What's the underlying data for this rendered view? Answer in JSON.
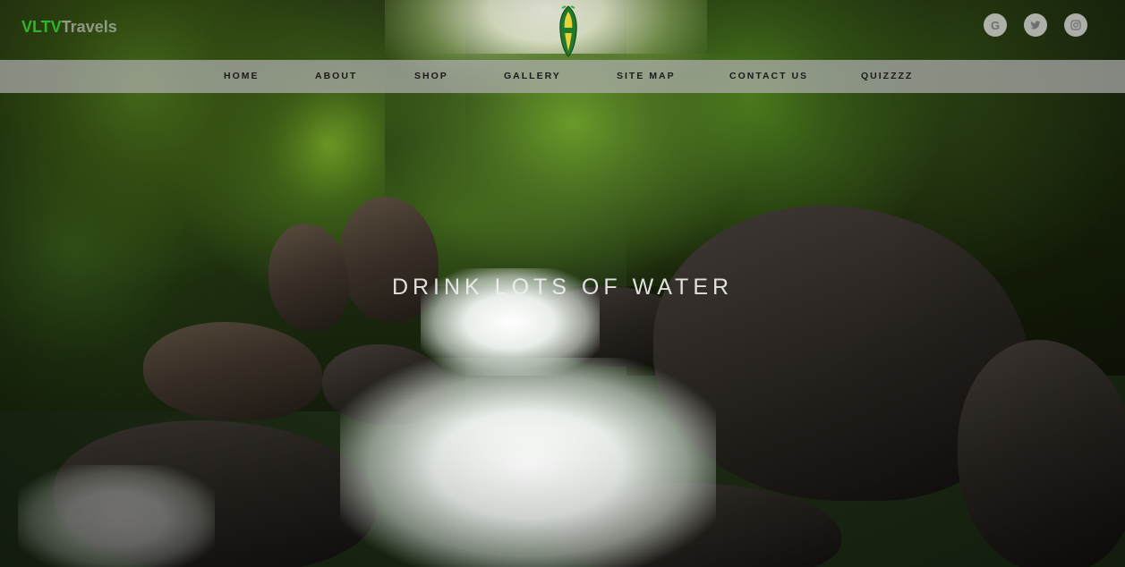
{
  "brand": {
    "part1": "VLTV",
    "part2": "Travels"
  },
  "logo": {
    "icon": "vltv-leaf-logo-icon"
  },
  "socials": [
    {
      "name": "google-icon",
      "glyph": "G"
    },
    {
      "name": "twitter-icon",
      "glyph": "🐦"
    },
    {
      "name": "instagram-icon",
      "glyph": "◎"
    }
  ],
  "nav": {
    "items": [
      {
        "label": "HOME"
      },
      {
        "label": "ABOUT"
      },
      {
        "label": "SHOP"
      },
      {
        "label": "GALLERY"
      },
      {
        "label": "SITE MAP"
      },
      {
        "label": "CONTACT US"
      },
      {
        "label": "QUIZZZZ"
      }
    ]
  },
  "hero": {
    "headline": "DRINK LOTS OF WATER"
  },
  "colors": {
    "brand_green": "#2fb52a",
    "navbar": "#afafaf"
  }
}
